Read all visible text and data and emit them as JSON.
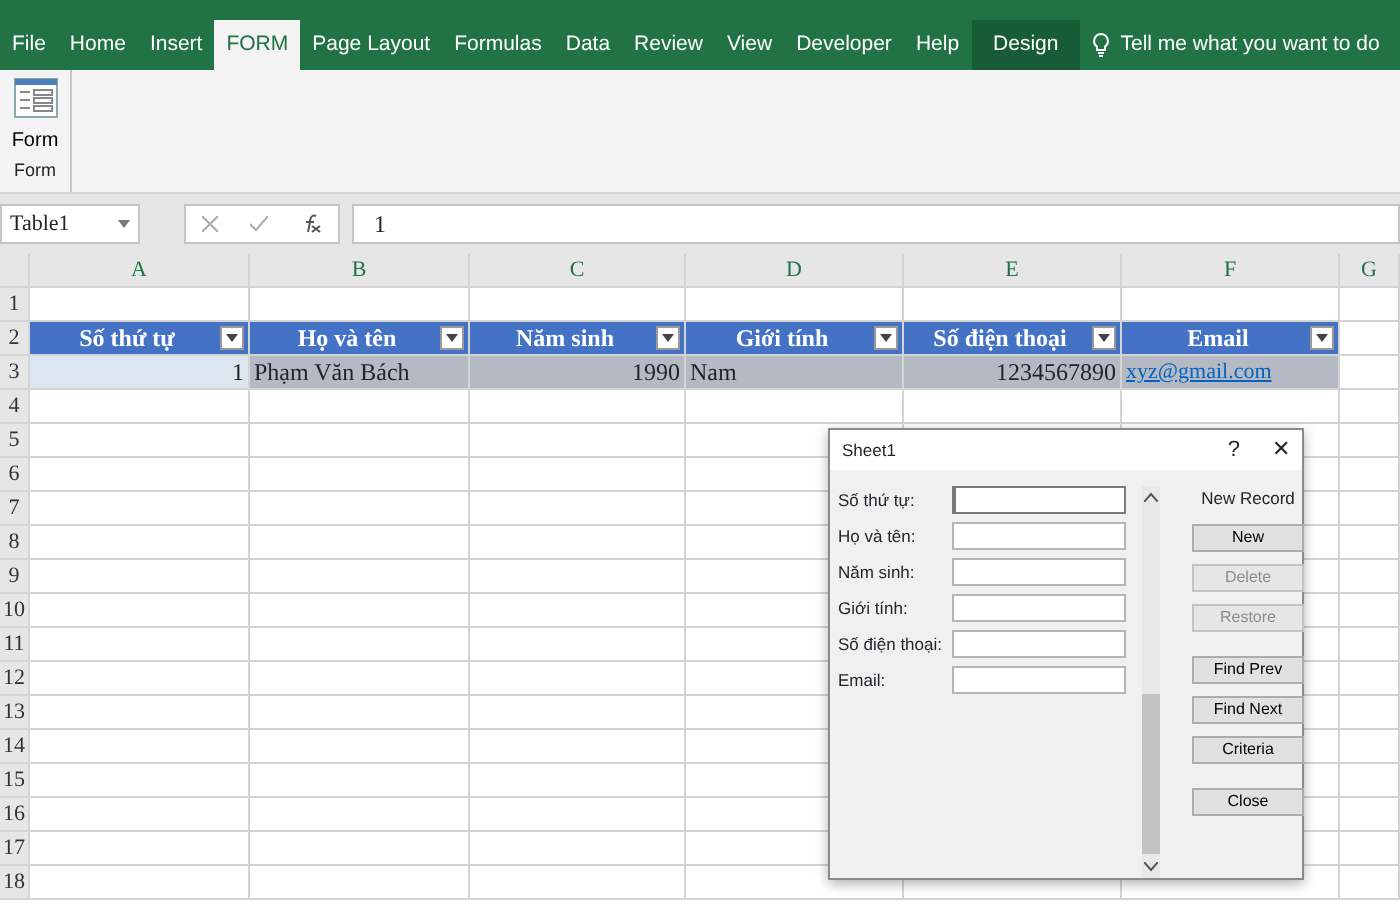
{
  "ribbon_tabs": [
    {
      "label": "File",
      "selected": false,
      "kind": "file"
    },
    {
      "label": "Home",
      "selected": false,
      "kind": "tab"
    },
    {
      "label": "Insert",
      "selected": false,
      "kind": "tab"
    },
    {
      "label": "FORM",
      "selected": true,
      "kind": "tab"
    },
    {
      "label": "Page Layout",
      "selected": false,
      "kind": "tab"
    },
    {
      "label": "Formulas",
      "selected": false,
      "kind": "tab"
    },
    {
      "label": "Data",
      "selected": false,
      "kind": "tab"
    },
    {
      "label": "Review",
      "selected": false,
      "kind": "tab"
    },
    {
      "label": "View",
      "selected": false,
      "kind": "tab"
    },
    {
      "label": "Developer",
      "selected": false,
      "kind": "tab"
    },
    {
      "label": "Help",
      "selected": false,
      "kind": "tab"
    },
    {
      "label": "Design",
      "selected": false,
      "kind": "contextual"
    }
  ],
  "tell_me": "Tell me what you want to do",
  "ribbon": {
    "button": "Form",
    "group": "Form"
  },
  "formula_bar": {
    "name_box": "Table1",
    "value": "1"
  },
  "columns": [
    "A",
    "B",
    "C",
    "D",
    "E",
    "F",
    "G"
  ],
  "row_numbers": [
    "1",
    "2",
    "3",
    "4",
    "5",
    "6",
    "7",
    "8",
    "9",
    "10",
    "11",
    "12",
    "13",
    "14",
    "15",
    "16",
    "17",
    "18"
  ],
  "table": {
    "headers": [
      "Số thứ tự",
      "Họ và tên",
      "Năm sinh",
      "Giới tính",
      "Số điện thoại",
      "Email"
    ],
    "rows": [
      {
        "selected": true,
        "cells": [
          "1",
          "Phạm Văn Bách",
          "1990",
          "Nam",
          "1234567890",
          "xyz@gmail.com"
        ]
      }
    ]
  },
  "dialog": {
    "title": "Sheet1",
    "help": "?",
    "close": "✕",
    "fields": [
      {
        "label": "Số thứ tự:",
        "focused": true
      },
      {
        "label": "Họ và tên:",
        "focused": false
      },
      {
        "label": "Năm sinh:",
        "focused": false
      },
      {
        "label": "Giới tính:",
        "focused": false
      },
      {
        "label": "Số điện thoại:",
        "focused": false
      },
      {
        "label": "Email:",
        "focused": false
      }
    ],
    "record_status": "New Record",
    "button_groups": [
      [
        {
          "label": "New",
          "disabled": false
        },
        {
          "label": "Delete",
          "disabled": true
        },
        {
          "label": "Restore",
          "disabled": true
        }
      ],
      [
        {
          "label": "Find Prev",
          "disabled": false
        },
        {
          "label": "Find Next",
          "disabled": false
        },
        {
          "label": "Criteria",
          "disabled": false
        }
      ],
      [
        {
          "label": "Close",
          "disabled": false
        }
      ]
    ]
  }
}
